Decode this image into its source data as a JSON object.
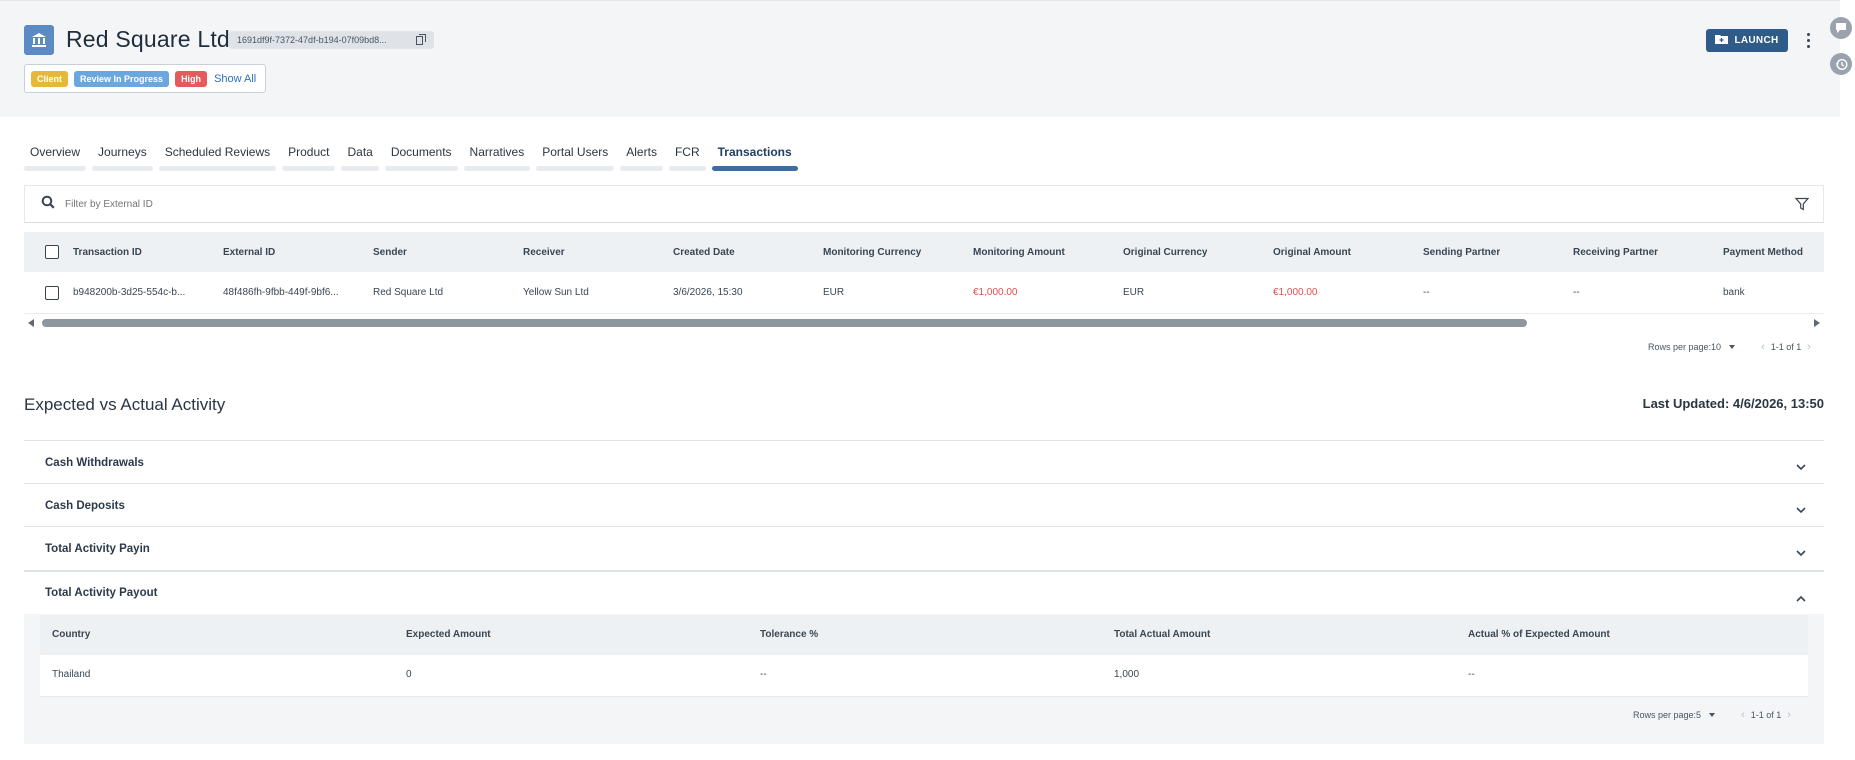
{
  "header": {
    "entity_name": "Red Square Ltd",
    "entity_id": "1691df9f-7372-47df-b194-07f09bd8...",
    "tags": [
      "Client",
      "Review In Progress",
      "High"
    ],
    "show_all": "Show All",
    "launch_label": "LAUNCH"
  },
  "tabs": [
    {
      "label": "Overview"
    },
    {
      "label": "Journeys"
    },
    {
      "label": "Scheduled Reviews"
    },
    {
      "label": "Product"
    },
    {
      "label": "Data"
    },
    {
      "label": "Documents"
    },
    {
      "label": "Narratives"
    },
    {
      "label": "Portal Users"
    },
    {
      "label": "Alerts"
    },
    {
      "label": "FCR"
    },
    {
      "label": "Transactions",
      "active": true
    }
  ],
  "filter": {
    "placeholder": "Filter by External ID"
  },
  "transactions": {
    "columns": [
      "Transaction ID",
      "External ID",
      "Sender",
      "Receiver",
      "Created Date",
      "Monitoring Currency",
      "Monitoring Amount",
      "Original Currency",
      "Original Amount",
      "Sending Partner",
      "Receiving Partner",
      "Payment Method"
    ],
    "rows": [
      [
        "b948200b-3d25-554c-b...",
        "48f486fh-9fbb-449f-9bf6...",
        "Red Square Ltd",
        "Yellow Sun Ltd",
        "3/6/2026, 15:30",
        "EUR",
        "€1,000.00",
        "EUR",
        "€1,000.00",
        "--",
        "--",
        "bank"
      ]
    ],
    "rows_per_page_label": "Rows per page:",
    "rows_per_page": "10",
    "range": "1-1 of 1"
  },
  "activity": {
    "title": "Expected vs Actual Activity",
    "last_updated": "Last Updated: 4/6/2026, 13:50",
    "sections": [
      {
        "label": "Cash Withdrawals",
        "expanded": false
      },
      {
        "label": "Cash Deposits",
        "expanded": false
      },
      {
        "label": "Total Activity Payin",
        "expanded": false
      },
      {
        "label": "Total Activity Payout",
        "expanded": true
      }
    ],
    "payout_table": {
      "columns": [
        "Country",
        "Expected Amount",
        "Tolerance %",
        "Total Actual Amount",
        "Actual % of Expected Amount"
      ],
      "rows": [
        [
          "Thailand",
          "0",
          "--",
          "1,000",
          "--"
        ]
      ],
      "rows_per_page_label": "Rows per page:",
      "rows_per_page": "5",
      "range": "1-1 of 1"
    }
  },
  "colors": {
    "primary": "#2e5b87",
    "tab_active": "#3b6ea5",
    "amount_red": "#e0524f",
    "tag_client": "#e6b73b",
    "tag_review": "#6aa7de",
    "tag_high": "#e45b5b"
  }
}
